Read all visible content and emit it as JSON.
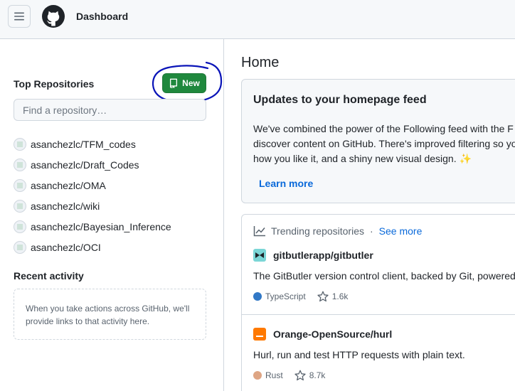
{
  "header": {
    "title": "Dashboard",
    "menu_icon": "hamburger-icon",
    "logo_icon": "github-mark-icon"
  },
  "sidebar": {
    "top_repos_heading": "Top Repositories",
    "new_button_label": "New",
    "find_placeholder": "Find a repository…",
    "repositories": [
      {
        "name": "asanchezlc/TFM_codes"
      },
      {
        "name": "asanchezlc/Draft_Codes"
      },
      {
        "name": "asanchezlc/OMA"
      },
      {
        "name": "asanchezlc/wiki"
      },
      {
        "name": "asanchezlc/Bayesian_Inference"
      },
      {
        "name": "asanchezlc/OCI"
      }
    ],
    "recent_activity_heading": "Recent activity",
    "recent_activity_empty_line1": "When you take actions across GitHub, we'll",
    "recent_activity_empty_line2": "provide links to that activity here."
  },
  "main": {
    "home_title": "Home",
    "updates": {
      "title": "Updates to your homepage feed",
      "line1": "We've combined the power of the Following feed with the F",
      "line2": "discover content on GitHub. There's improved filtering so yo",
      "line3": "how you like it, and a shiny new visual design.",
      "learn_more": "Learn more"
    },
    "trending": {
      "heading": "Trending repositories",
      "separator": "·",
      "see_more": "See more",
      "items": [
        {
          "name": "gitbutlerapp/gitbutler",
          "description": "The GitButler version control client, backed by Git, powered",
          "language": "TypeScript",
          "language_color": "#3178c6",
          "stars": "1.6k"
        },
        {
          "name": "Orange-OpenSource/hurl",
          "description": "Hurl, run and test HTTP requests with plain text.",
          "language": "Rust",
          "language_color": "#dea584",
          "stars": "8.7k"
        }
      ]
    }
  },
  "colors": {
    "primary_button": "#1f883d",
    "link": "#0969da",
    "annotation_circle": "#0a14b8"
  }
}
